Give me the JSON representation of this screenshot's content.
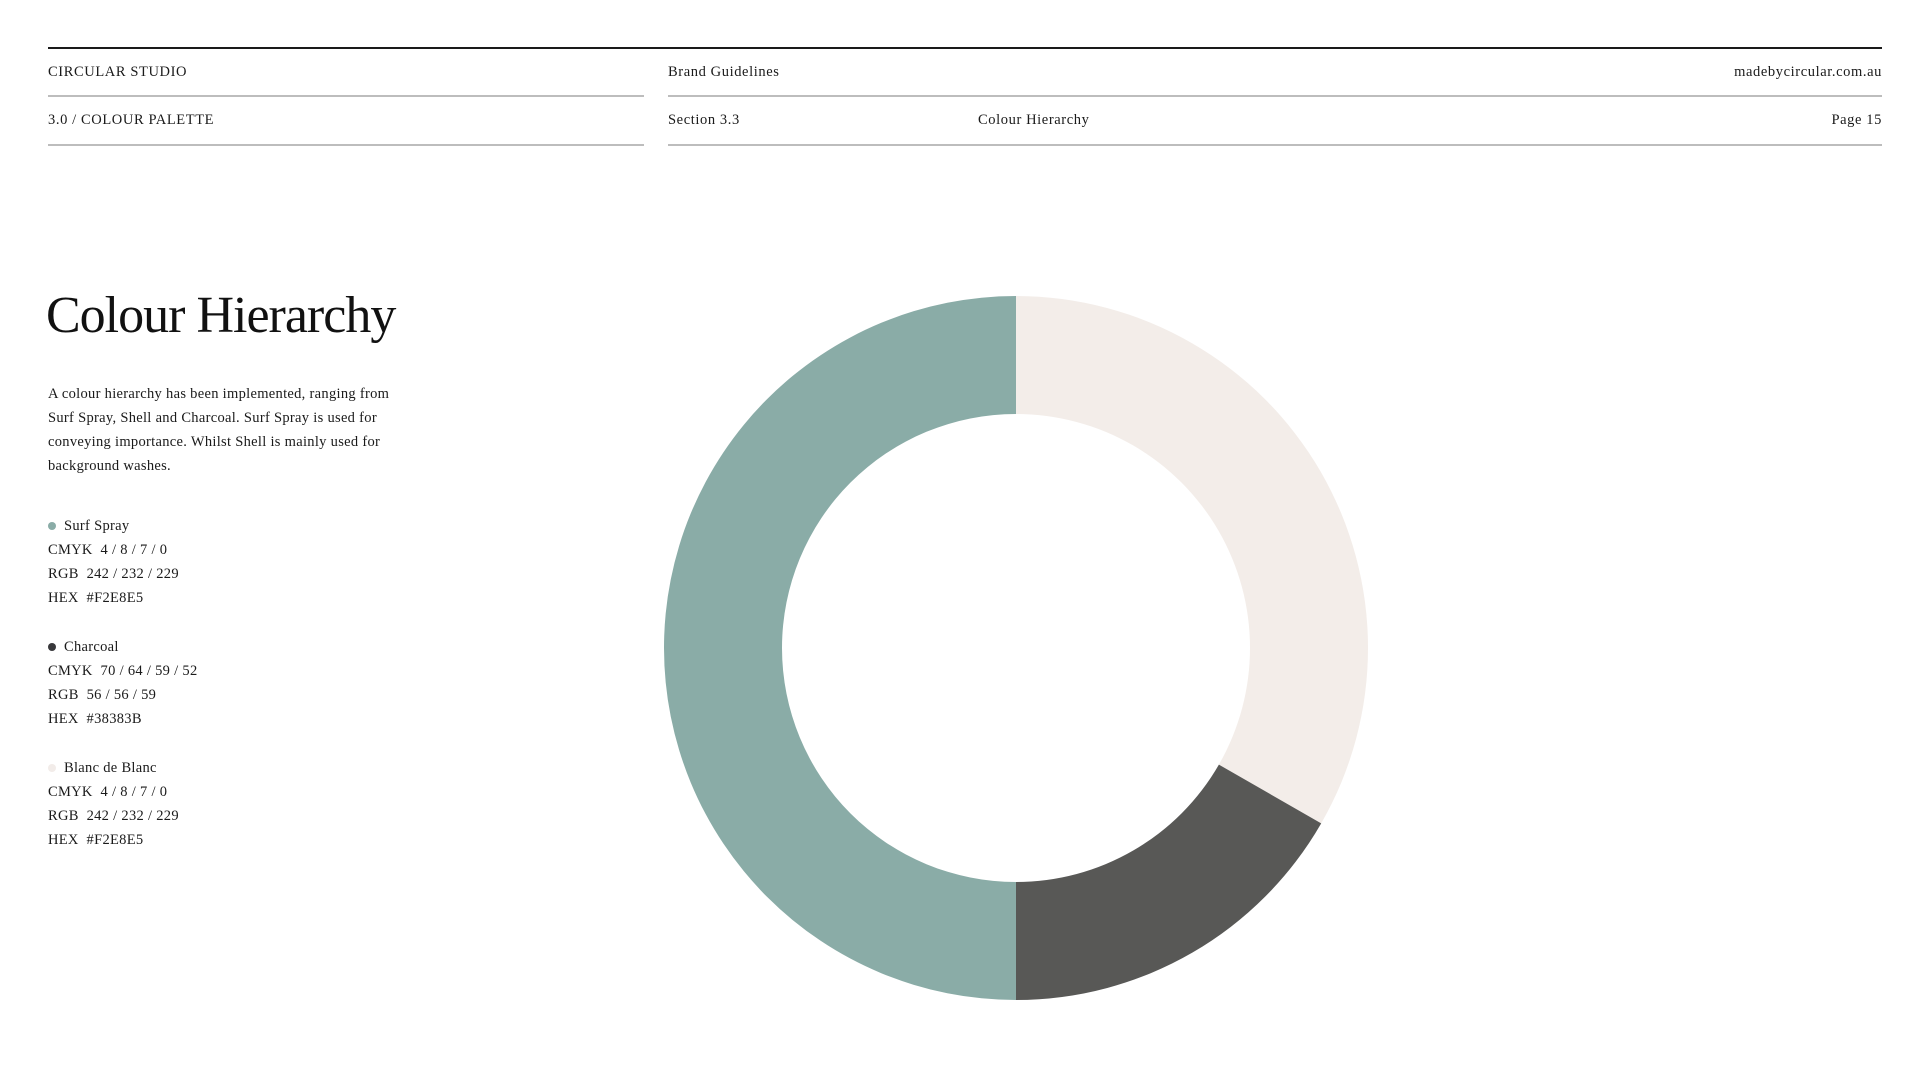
{
  "header": {
    "studio": "CIRCULAR STUDIO",
    "doc": "Brand Guidelines",
    "website": "madebycircular.com.au",
    "chapter": "3.0 / COLOUR PALETTE",
    "section": "Section 3.3",
    "section_title": "Colour Hierarchy",
    "page": "Page 15"
  },
  "main": {
    "title": "Colour Hierarchy",
    "description": "A colour hierarchy has been implemented, ranging from Surf Spray, Shell and Charcoal. Surf Spray is used for conveying importance. Whilst Shell is mainly used for background washes."
  },
  "swatches": [
    {
      "name": "Surf Spray",
      "dot_color": "#8aaca7",
      "cmyk": "CMYK  4 / 8 / 7 / 0",
      "rgb": "RGB  242 / 232 / 229",
      "hex": "HEX  #F2E8E5"
    },
    {
      "name": "Charcoal",
      "dot_color": "#38383b",
      "cmyk": "CMYK  70 / 64 / 59 / 52",
      "rgb": "RGB  56 / 56 / 59",
      "hex": "HEX  #38383B"
    },
    {
      "name": "Blanc de Blanc",
      "dot_color": "#f2ece9",
      "cmyk": "CMYK  4 / 8 / 7 / 0",
      "rgb": "RGB  242 / 232 / 229",
      "hex": "HEX  #F2E8E5"
    }
  ],
  "chart_data": {
    "type": "pie",
    "donut": true,
    "slices": [
      {
        "label": "Blanc de Blanc",
        "value": 33.3,
        "color": "#f3ede9"
      },
      {
        "label": "Charcoal",
        "value": 16.7,
        "color": "#585856"
      },
      {
        "label": "Surf Spray",
        "value": 50,
        "color": "#8aaca7"
      }
    ],
    "start_angle_deg": 0,
    "direction": "clockwise"
  }
}
